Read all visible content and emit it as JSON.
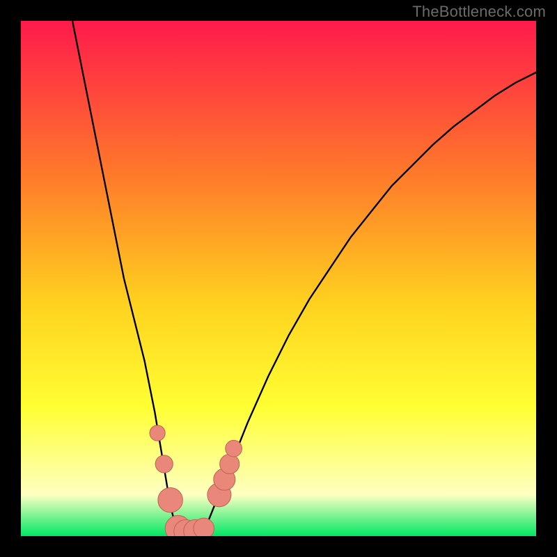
{
  "watermark": "TheBottleneck.com",
  "colors": {
    "frame": "#000000",
    "grad_top": "#ff1a4b",
    "grad_mid_upper": "#ff7a2a",
    "grad_mid": "#ffd21f",
    "grad_mid_lower": "#ffff33",
    "grad_pale": "#feffc2",
    "grad_bottom": "#00e763",
    "curve": "#000000",
    "marker_fill": "#e9877a",
    "marker_stroke": "#c06156"
  },
  "chart_data": {
    "type": "line",
    "title": "",
    "xlabel": "",
    "ylabel": "",
    "xlim": [
      0,
      100
    ],
    "ylim": [
      0,
      100
    ],
    "series": [
      {
        "name": "curve",
        "x": [
          10,
          12,
          14,
          16,
          18,
          20,
          22,
          24,
          26,
          27,
          28,
          29,
          30,
          31,
          32,
          33,
          34,
          36,
          38,
          40,
          44,
          48,
          52,
          56,
          60,
          64,
          68,
          72,
          76,
          80,
          84,
          88,
          92,
          96,
          100
        ],
        "y": [
          100,
          90,
          80,
          70,
          60,
          50,
          42,
          34,
          24,
          18,
          12,
          6,
          2,
          0.8,
          0.5,
          0.5,
          0.8,
          2,
          7,
          12,
          22,
          31,
          39,
          46,
          52,
          58,
          63,
          68,
          72,
          76,
          79.5,
          82.5,
          85.5,
          88,
          90
        ]
      }
    ],
    "markers": [
      {
        "x": 26.5,
        "y": 20,
        "r": 1.5
      },
      {
        "x": 27.8,
        "y": 14,
        "r": 1.7
      },
      {
        "x": 29.0,
        "y": 7,
        "r": 2.4
      },
      {
        "x": 30.5,
        "y": 1.5,
        "r": 2.5
      },
      {
        "x": 32.0,
        "y": 0.9,
        "r": 2.3
      },
      {
        "x": 33.8,
        "y": 1.0,
        "r": 2.2
      },
      {
        "x": 35.5,
        "y": 1.5,
        "r": 2.0
      },
      {
        "x": 38.5,
        "y": 8,
        "r": 2.3
      },
      {
        "x": 39.5,
        "y": 11,
        "r": 2.1
      },
      {
        "x": 40.5,
        "y": 14,
        "r": 1.9
      },
      {
        "x": 41.3,
        "y": 17,
        "r": 1.6
      }
    ],
    "gradient_stops": [
      {
        "offset": 0.0,
        "key": "grad_top"
      },
      {
        "offset": 0.3,
        "key": "grad_mid_upper"
      },
      {
        "offset": 0.55,
        "key": "grad_mid"
      },
      {
        "offset": 0.75,
        "key": "grad_mid_lower"
      },
      {
        "offset": 0.92,
        "key": "grad_pale"
      },
      {
        "offset": 1.0,
        "key": "grad_bottom"
      }
    ]
  }
}
